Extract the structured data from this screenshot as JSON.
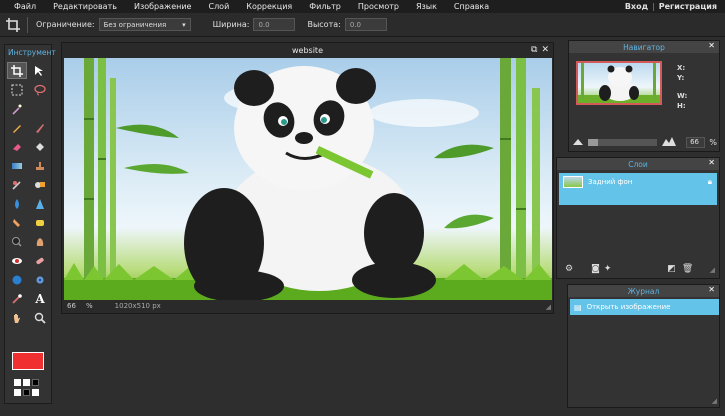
{
  "menu": {
    "items": [
      "Файл",
      "Редактировать",
      "Изображение",
      "Слой",
      "Коррекция",
      "Фильтр",
      "Просмотр",
      "Язык",
      "Справка"
    ],
    "login": "Вход",
    "separator": "|",
    "register": "Регистрация"
  },
  "options": {
    "constraint_label": "Ограничение:",
    "constraint_value": "Без ограничения",
    "width_label": "Ширина:",
    "width_value": "0.0",
    "height_label": "Высота:",
    "height_value": "0.0"
  },
  "toolbox": {
    "title": "Инструмент",
    "foreground_color": "#f03030"
  },
  "document": {
    "title": "website",
    "zoom": "66",
    "zoom_unit": "%",
    "dimensions": "1020x510 px"
  },
  "navigator": {
    "title": "Навигатор",
    "x_label": "X:",
    "y_label": "Y:",
    "w_label": "W:",
    "h_label": "H:",
    "zoom_value": "66",
    "zoom_unit": "%",
    "zoom_level": 0.15
  },
  "layers": {
    "title": "Слои",
    "items": [
      {
        "name": "Задний фон"
      }
    ]
  },
  "journal": {
    "title": "Журнал",
    "items": [
      {
        "label": "Открыть изображение"
      }
    ]
  },
  "colors": {
    "accent": "#64c3e8",
    "panel_title": "#5fb4e0",
    "foreground": "#f03030"
  }
}
